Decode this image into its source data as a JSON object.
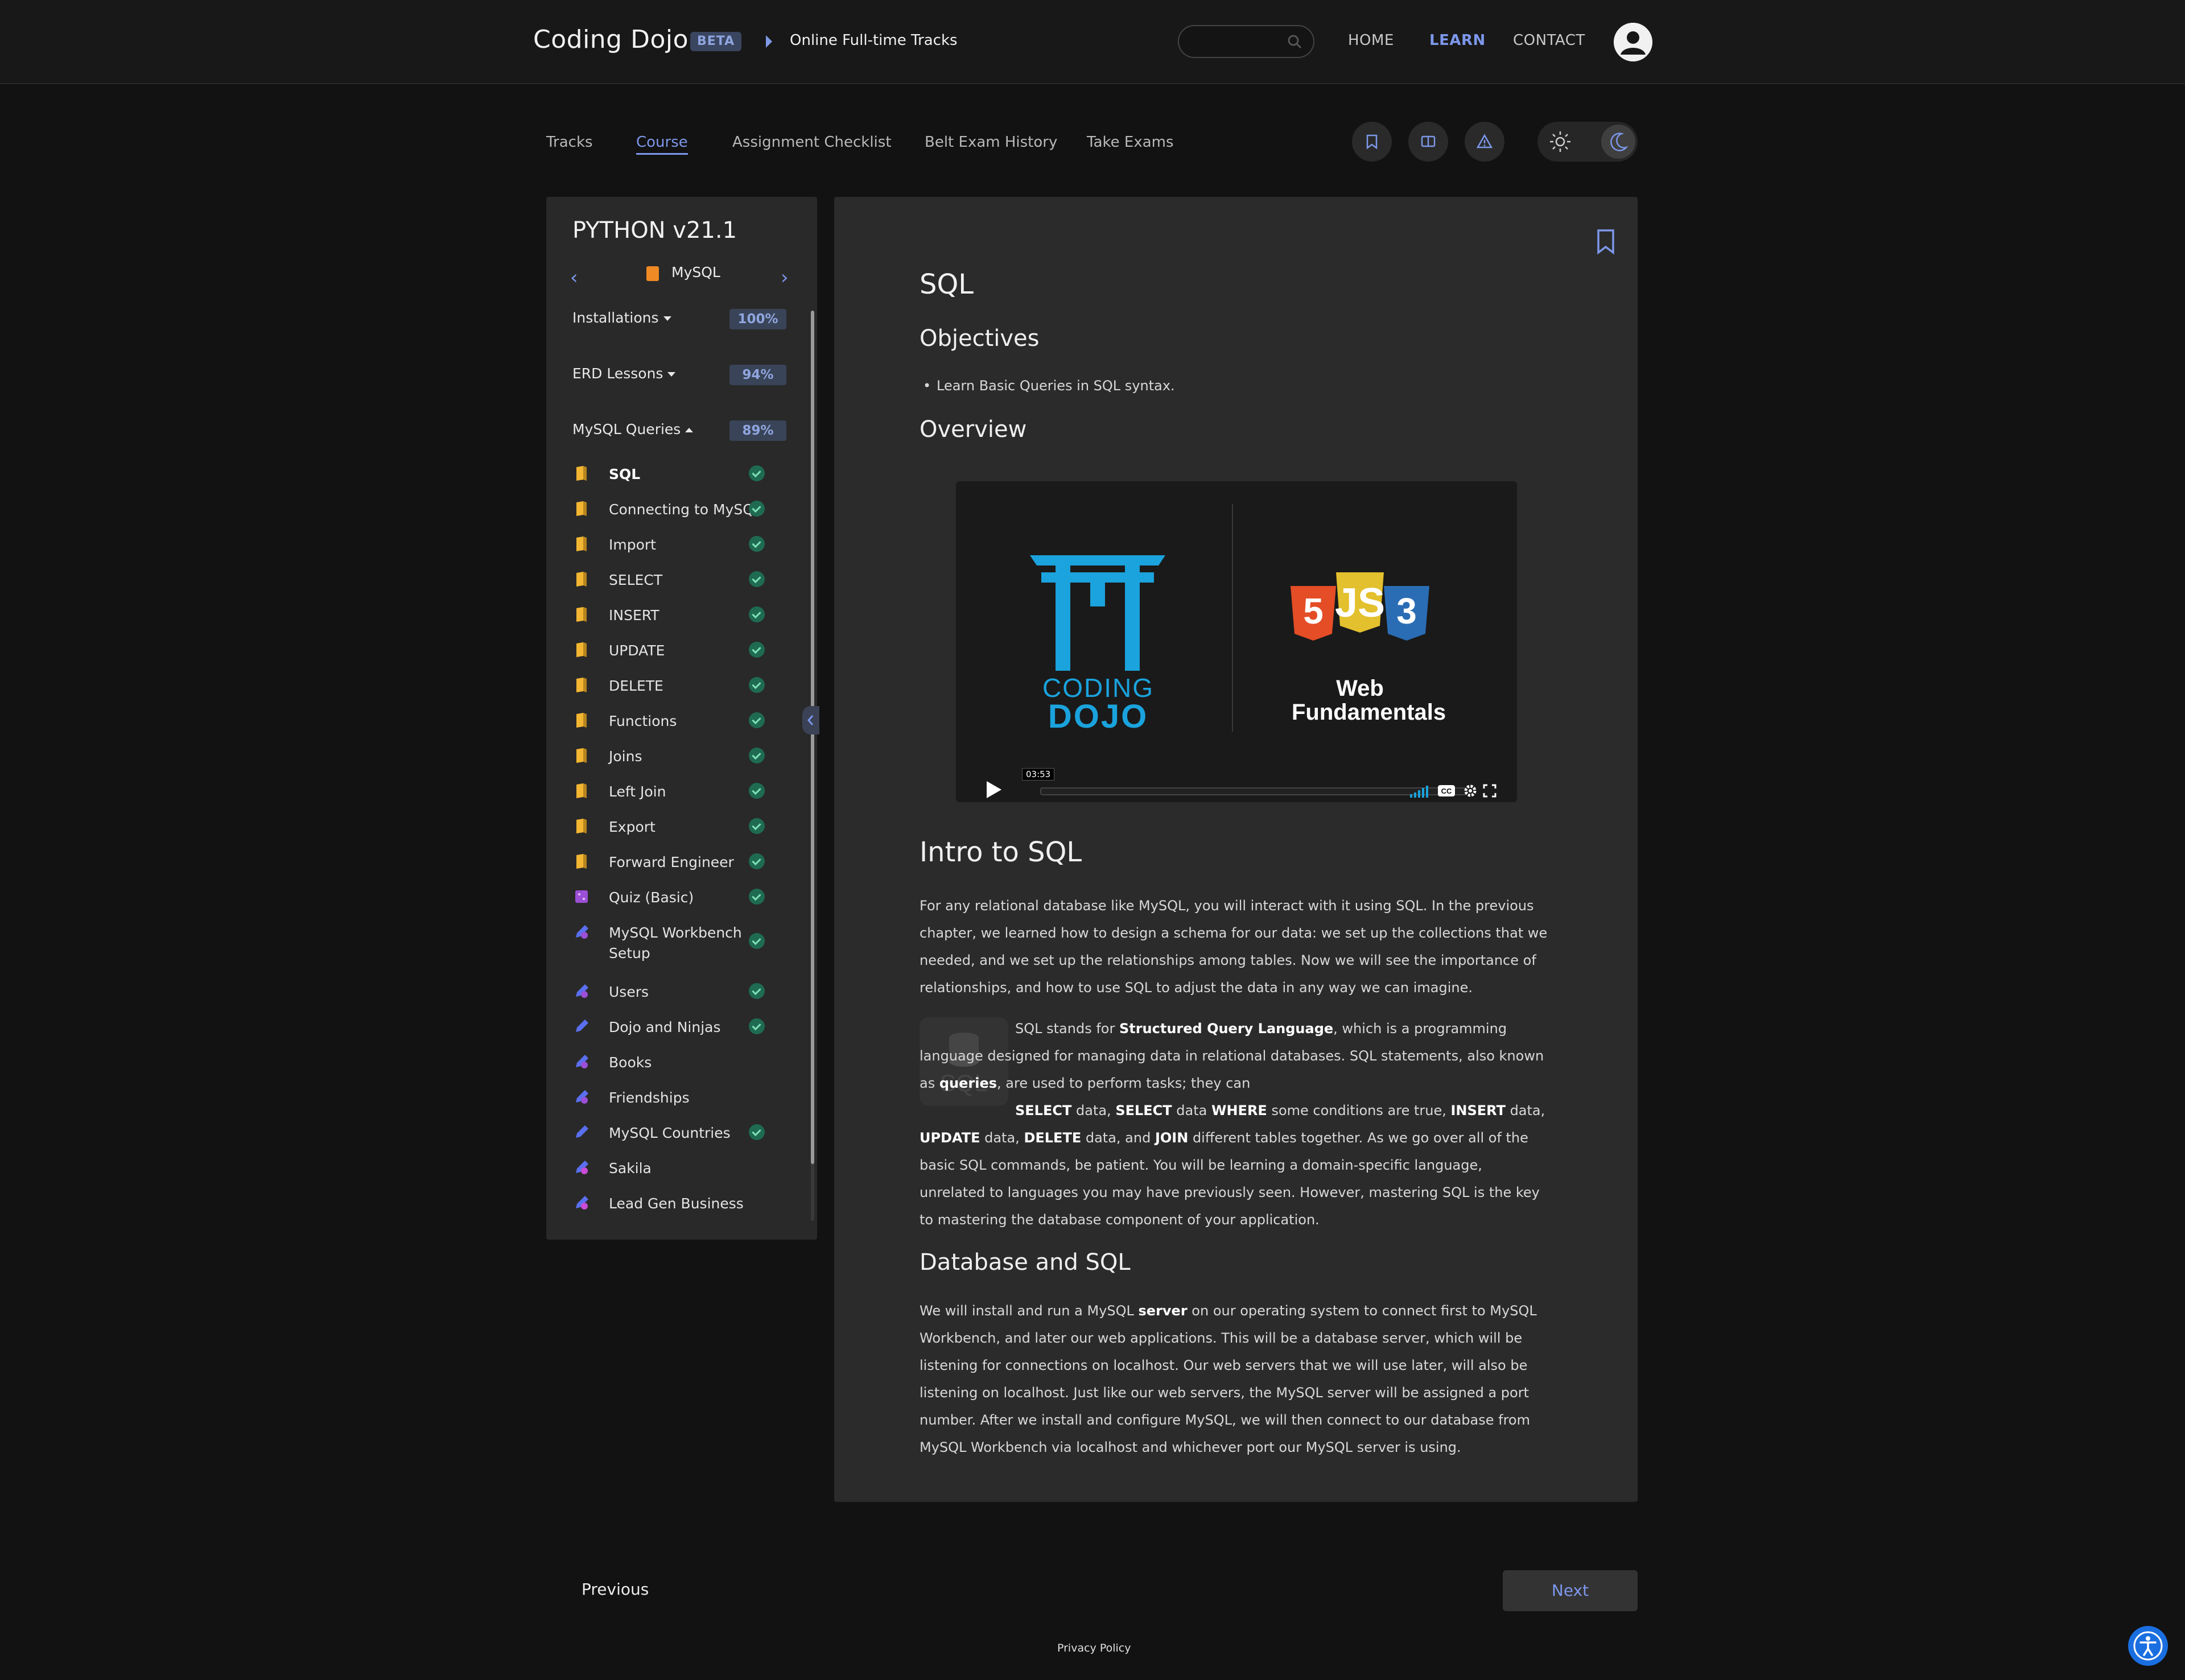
{
  "header": {
    "brand": "Coding Dojo",
    "badge": "BETA",
    "breadcrumb": "Online Full-time Tracks",
    "search_placeholder": "",
    "nav": {
      "home": "HOME",
      "learn": "LEARN",
      "contact": "CONTACT"
    }
  },
  "tabs": [
    "Tracks",
    "Course",
    "Assignment Checklist",
    "Belt Exam History",
    "Take Exams"
  ],
  "active_tab": "Course",
  "sidebar": {
    "title": "PYTHON v21.1",
    "module": "MySQL",
    "sections": [
      {
        "label": "Installations",
        "percent": "100%"
      },
      {
        "label": "ERD Lessons",
        "percent": "94%"
      },
      {
        "label": "MySQL Queries",
        "percent": "89%"
      }
    ],
    "lessons": [
      {
        "label": "SQL",
        "type": "reading",
        "done": true,
        "active": true
      },
      {
        "label": "Connecting to MySQL",
        "type": "reading",
        "done": true
      },
      {
        "label": "Import",
        "type": "reading",
        "done": true
      },
      {
        "label": "SELECT",
        "type": "reading",
        "done": true
      },
      {
        "label": "INSERT",
        "type": "reading",
        "done": true
      },
      {
        "label": "UPDATE",
        "type": "reading",
        "done": true
      },
      {
        "label": "DELETE",
        "type": "reading",
        "done": true
      },
      {
        "label": "Functions",
        "type": "reading",
        "done": true
      },
      {
        "label": "Joins",
        "type": "reading",
        "done": true
      },
      {
        "label": "Left Join",
        "type": "reading",
        "done": true
      },
      {
        "label": "Export",
        "type": "reading",
        "done": true
      },
      {
        "label": "Forward Engineer",
        "type": "reading",
        "done": true
      },
      {
        "label": "Quiz (Basic)",
        "type": "quiz",
        "done": true
      },
      {
        "label": "MySQL Workbench Setup",
        "label_lines": [
          "MySQL Workbench",
          "Setup"
        ],
        "type": "assignment",
        "done": true
      },
      {
        "label": "Users",
        "type": "assignment",
        "done": true
      },
      {
        "label": "Dojo and Ninjas",
        "type": "assignment",
        "done": true
      },
      {
        "label": "Books",
        "type": "assignment",
        "done": false
      },
      {
        "label": "Friendships",
        "type": "assignment",
        "done": false
      },
      {
        "label": "MySQL Countries",
        "type": "assignment",
        "done": true
      },
      {
        "label": "Sakila",
        "type": "assignment-optional",
        "done": false
      },
      {
        "label": "Lead Gen Business",
        "type": "assignment-optional",
        "done": false
      }
    ]
  },
  "content": {
    "title": "SQL",
    "objectives_heading": "Objectives",
    "objective": "Learn Basic Queries in SQL syntax.",
    "overview_heading": "Overview",
    "video": {
      "logo_line1": "CODING",
      "logo_line2": "DOJO",
      "course_line1": "Web",
      "course_line2": "Fundamentals",
      "time": "03:53"
    },
    "intro_heading": "Intro to SQL",
    "intro_para": "For any relational database like MySQL, you will interact with it using SQL. In the previous chapter, we learned how to design a schema for our data: we set up the collections that we needed, and we set up the relationships among tables. Now we will see the importance of relationships, and how to use SQL to adjust the data in any way we can imagine.",
    "sql_para_parts": {
      "p1": "SQL stands for ",
      "b1": "Structured Query Language",
      "p2": ", which is a programming language designed for managing data in relational databases. SQL statements, also known as ",
      "b2": "queries",
      "p3": ", are used to perform tasks; they can ",
      "b3": "SELECT",
      "p4": " data, ",
      "b4": "SELECT",
      "p5": " data ",
      "b5": "WHERE",
      "p6": " some conditions are true, ",
      "b6": "INSERT",
      "p7": " data, ",
      "b7": "UPDATE",
      "p8": " data, ",
      "b8": "DELETE",
      "p9": " data, and ",
      "b9": "JOIN",
      "p10": " different tables together. As we go over all of the basic SQL commands, be patient. You will be learning a domain-specific language, unrelated to languages you may have previously seen. However, mastering SQL is the key to mastering the database component of your application."
    },
    "sql_icon_text": "SQL",
    "db_heading": "Database and SQL",
    "db_parts": {
      "p1": "We will install and run a MySQL ",
      "b1": "server",
      "p2": " on our operating system to connect first to MySQL Workbench, and later our web applications. This will be a database server, which will be listening for connections on localhost.  Our web servers that we will use later, will also be listening on localhost. Just like our web servers, the MySQL server will be assigned a port number. After we install and configure MySQL, we will then connect to our database from MySQL Workbench via localhost and whichever port our MySQL server is using."
    }
  },
  "footer": {
    "previous": "Previous",
    "next": "Next",
    "privacy": "Privacy Policy"
  },
  "colors": {
    "accent": "#7d97ea",
    "background": "#121212",
    "panel": "#2b2b2b",
    "check": "#1e6b52",
    "reading_icon": "#f2b632",
    "quiz_icon": "#9b4fd6",
    "assignment_icon": "#5a6ff0"
  }
}
